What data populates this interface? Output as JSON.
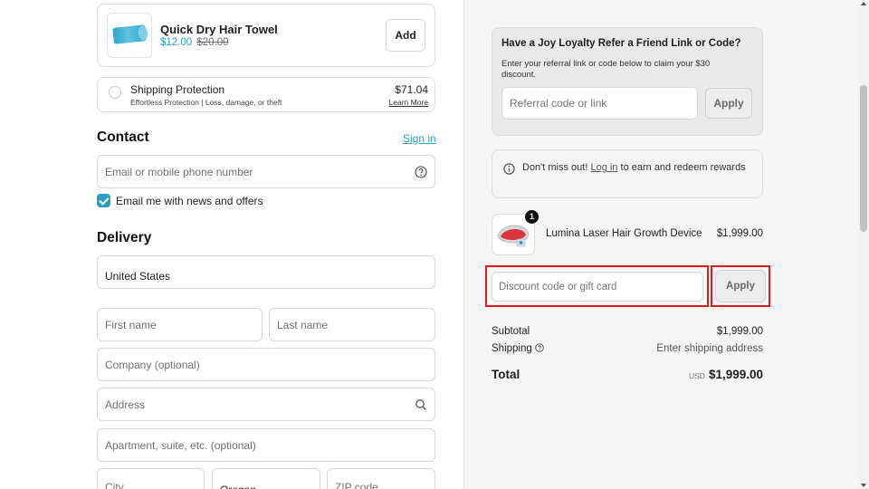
{
  "upsell": {
    "title": "Quick Dry Hair Towel",
    "price": "$12.00",
    "compare_price": "$20.00",
    "add_label": "Add",
    "image_icon": "towel-product-image"
  },
  "protection": {
    "name": "Shipping Protection",
    "description": "Effortless Protection | Loss, damage, or theft",
    "amount": "$71.04",
    "learn_more": "Learn More"
  },
  "contact": {
    "heading": "Contact",
    "sign_in": "Sign in",
    "email_placeholder": "Email or mobile phone number",
    "news_label": "Email me with news and offers",
    "news_checked": true
  },
  "delivery": {
    "heading": "Delivery",
    "country": "United States",
    "first_name_placeholder": "First name",
    "last_name_placeholder": "Last name",
    "company_placeholder": "Company (optional)",
    "address_placeholder": "Address",
    "apartment_placeholder": "Apartment, suite, etc. (optional)",
    "city_placeholder": "City",
    "state": "Oregon",
    "zip_placeholder": "ZIP code"
  },
  "referral": {
    "title": "Have a Joy Loyalty Refer a Friend Link or Code?",
    "description": "Enter your referral link or code below to claim your $30 discount.",
    "placeholder": "Referral code or link",
    "apply_label": "Apply"
  },
  "notice": {
    "prefix": "Don't miss out!",
    "link": "Log in",
    "suffix": "to earn and redeem rewards"
  },
  "cart_item": {
    "name": "Lumina Laser Hair Growth Device",
    "price": "$1,999.00",
    "quantity": "1"
  },
  "discount": {
    "placeholder": "Discount code or gift card",
    "apply_label": "Apply"
  },
  "summary": {
    "subtotal_label": "Subtotal",
    "subtotal_value": "$1,999.00",
    "shipping_label": "Shipping",
    "shipping_value": "Enter shipping address",
    "total_label": "Total",
    "currency": "USD",
    "total_value": "$1,999.00"
  },
  "colors": {
    "accent": "#2a9fbf",
    "highlight": "#d91b1b"
  }
}
